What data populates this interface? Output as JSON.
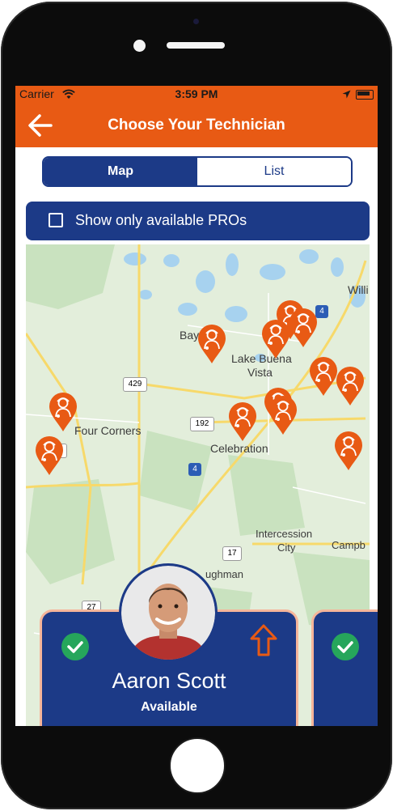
{
  "status_bar": {
    "carrier": "Carrier",
    "time": "3:59 PM"
  },
  "nav": {
    "title": "Choose Your Technician",
    "back_icon": "arrow-left-icon"
  },
  "view_toggle": {
    "options": [
      "Map",
      "List"
    ],
    "selected": "Map"
  },
  "filter": {
    "label": "Show only available PROs",
    "checked": false
  },
  "map": {
    "places": [
      "Bay",
      "Lake Buena",
      "Vista",
      "Willi",
      "Four Corners",
      "Celebration",
      "Intercession",
      "City",
      "Campb",
      "ughman"
    ],
    "road_shields": [
      "429",
      "192",
      "4",
      "4",
      "27",
      "27",
      "17"
    ],
    "marker_icon": "technician-pin-icon",
    "marker_count": 12
  },
  "technician_card": {
    "name": "Aaron Scott",
    "status": "Available",
    "verified_icon": "check-circle-icon",
    "action_icon": "arrow-up-outline-icon",
    "avatar_icon": "avatar-photo"
  },
  "colors": {
    "brand_orange": "#e85a14",
    "brand_navy": "#1c3a87",
    "success_green": "#26a65b"
  }
}
